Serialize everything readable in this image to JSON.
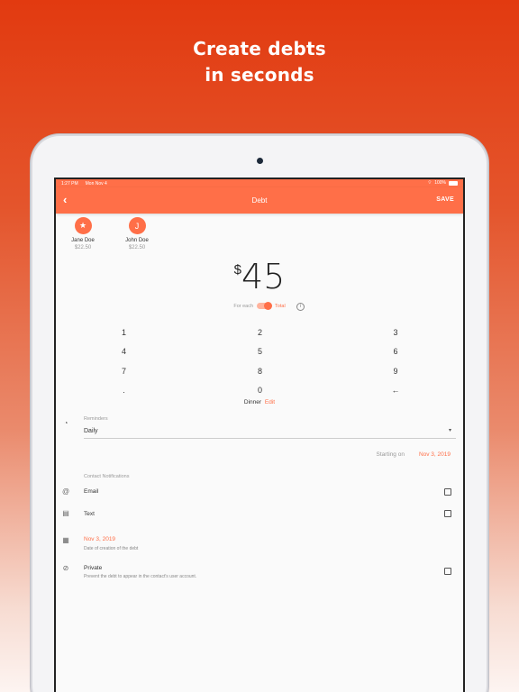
{
  "headline": {
    "line1": "Create debts",
    "line2": "in seconds"
  },
  "statusbar": {
    "time": "1:27 PM",
    "date": "Mon Nov 4",
    "battery": "100%"
  },
  "appbar": {
    "back_icon": "chevron-left-icon",
    "title": "Debt",
    "save_label": "SAVE"
  },
  "contacts": [
    {
      "initial": "★",
      "name": "Jane Doe",
      "amount": "$22.50"
    },
    {
      "initial": "J",
      "name": "John Doe",
      "amount": "$22.50"
    }
  ],
  "amount": {
    "currency": "$",
    "value": "45"
  },
  "split_toggle": {
    "left_label": "For each",
    "right_label": "Total",
    "selected": "Total",
    "info_icon": "i"
  },
  "keypad": [
    "1",
    "2",
    "3",
    "4",
    "5",
    "6",
    "7",
    "8",
    "9",
    ".",
    "0",
    "←"
  ],
  "tag": {
    "label": "Dinner",
    "edit_label": "Edit"
  },
  "reminders": {
    "label": "Reminders",
    "value": "Daily",
    "caret": "▾",
    "starting_label": "Starting on",
    "starting_date": "Nov 3, 2019"
  },
  "notifications": {
    "header": "Contact Notifications",
    "email_icon": "@",
    "email_label": "Email",
    "text_icon": "▤",
    "text_label": "Text"
  },
  "creation": {
    "icon": "▦",
    "date": "Nov 3, 2019",
    "subtitle": "Date of creation of the debt"
  },
  "private": {
    "icon": "⊘",
    "label": "Private",
    "subtitle": "Prevent the debt to appear in the contact's user account."
  },
  "colors": {
    "accent": "#ff6f48"
  }
}
